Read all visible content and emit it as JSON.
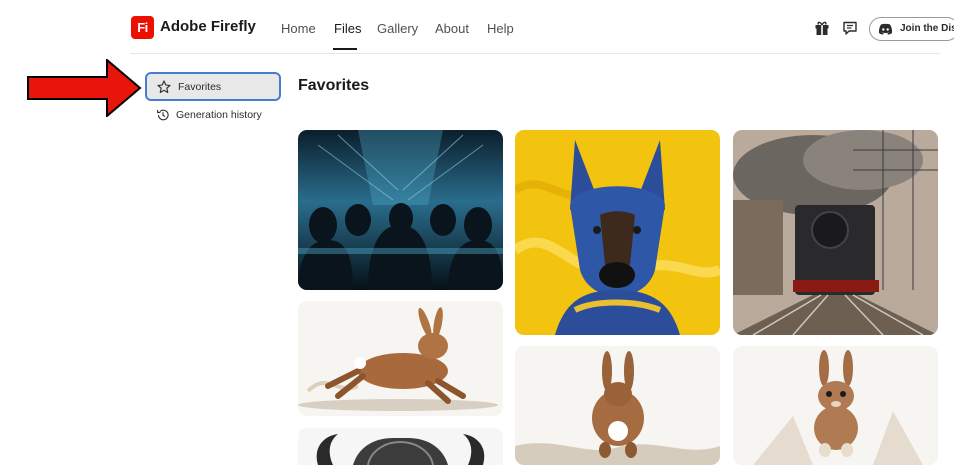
{
  "header": {
    "logo_text": "Fi",
    "app_name": "Adobe Firefly",
    "nav": [
      "Home",
      "Files",
      "Gallery",
      "About",
      "Help"
    ],
    "active_nav": "Files",
    "join_label": "Join the Discord",
    "icons": [
      "gift-icon",
      "feedback-icon",
      "discord-icon"
    ]
  },
  "sidebar": {
    "items": [
      {
        "label": "Favorites",
        "icon": "star-icon",
        "selected": true
      },
      {
        "label": "Generation history",
        "icon": "history-icon",
        "selected": false
      }
    ]
  },
  "main": {
    "title": "Favorites",
    "images": [
      {
        "name": "hooded-figures-server-room-image"
      },
      {
        "name": "blue-yellow-german-shepherd-image"
      },
      {
        "name": "steam-locomotive-image"
      },
      {
        "name": "running-rabbit-image"
      },
      {
        "name": "rabbit-running-away-image"
      },
      {
        "name": "rabbit-running-forward-image"
      },
      {
        "name": "horned-creature-image"
      }
    ]
  },
  "annotation": {
    "color": "#e8150b"
  },
  "colors": {
    "brand": "#eb1000",
    "selection_border": "#4a7bd0",
    "selection_bg": "#e8e8e8"
  }
}
